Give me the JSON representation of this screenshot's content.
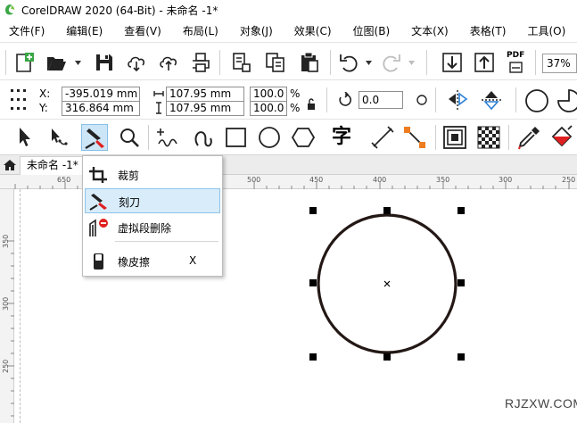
{
  "window": {
    "title": "CorelDRAW 2020 (64-Bit) - 未命名 -1*"
  },
  "menu": [
    {
      "label": "文件(F)"
    },
    {
      "label": "编辑(E)"
    },
    {
      "label": "查看(V)"
    },
    {
      "label": "布局(L)"
    },
    {
      "label": "对象(J)"
    },
    {
      "label": "效果(C)"
    },
    {
      "label": "位图(B)"
    },
    {
      "label": "文本(X)"
    },
    {
      "label": "表格(T)"
    },
    {
      "label": "工具(O)"
    }
  ],
  "toolbar": {
    "pdf_label": "PDF",
    "zoom": "37%"
  },
  "propbar": {
    "x_label": "X:",
    "y_label": "Y:",
    "x_value": "-395.019 mm",
    "y_value": "316.864 mm",
    "width_value": "107.95 mm",
    "height_value": "107.95 mm",
    "scale_x": "100.0",
    "scale_y": "100.0",
    "percent": "%",
    "rotation": "0.0"
  },
  "toolbox": {
    "text_tool_glyph": "字"
  },
  "document": {
    "tab_label": "未命名 -1*"
  },
  "ruler": {
    "top_labels": [
      "650",
      "500",
      "450",
      "400",
      "350",
      "300",
      "250"
    ],
    "left_labels": [
      "350",
      "300",
      "250"
    ]
  },
  "flyout": {
    "items": [
      {
        "label": "裁剪",
        "shortcut": ""
      },
      {
        "label": "刻刀",
        "shortcut": ""
      },
      {
        "label": "虚拟段删除",
        "shortcut": ""
      },
      {
        "label": "橡皮擦",
        "shortcut": "X"
      }
    ]
  },
  "watermark": "RJZXW.COM",
  "colors": {
    "circle_stroke": "#231815",
    "active_tool_bg": "#cde6f7",
    "selected_item_bg": "#d9ecfa",
    "logo_green": "#3aa645",
    "accent_red": "#e02020",
    "accent_orange": "#ee7d22"
  }
}
